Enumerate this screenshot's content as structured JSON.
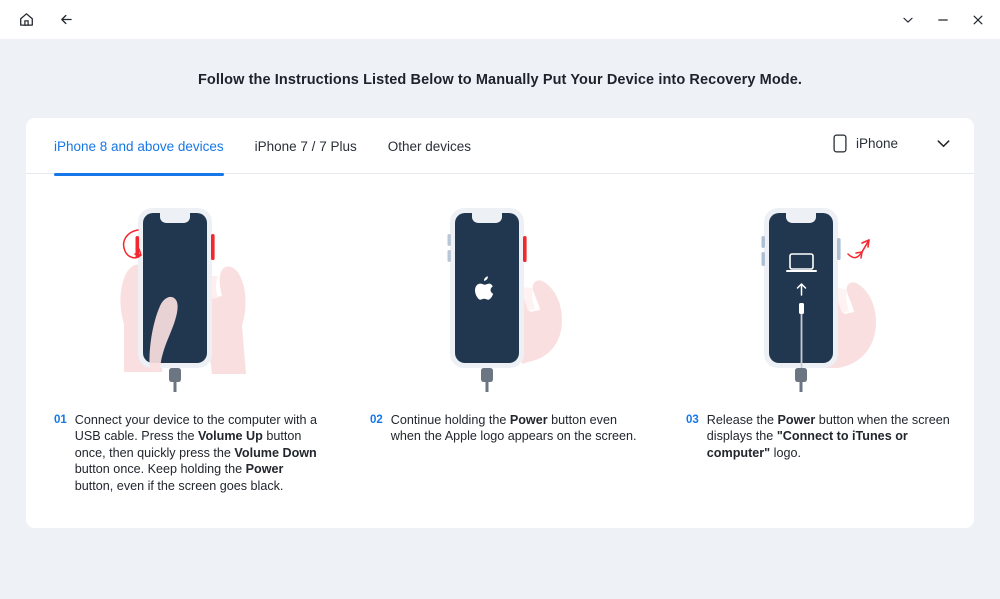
{
  "titlebar": {
    "home_icon": "home-icon",
    "back_icon": "back-arrow-icon",
    "menu_icon": "chevron-down-icon",
    "minimize_icon": "minimize-icon",
    "close_icon": "close-icon"
  },
  "heading": "Follow the Instructions Listed Below to Manually Put Your Device into Recovery Mode.",
  "tabs": [
    {
      "label": "iPhone 8 and above devices",
      "active": true
    },
    {
      "label": "iPhone 7 / 7 Plus",
      "active": false
    },
    {
      "label": "Other devices",
      "active": false
    }
  ],
  "device_select": {
    "icon": "phone-icon",
    "label": "iPhone",
    "chevron": "chevron-down-icon"
  },
  "steps": [
    {
      "number": "01",
      "text_html": "Connect your device to the computer with a USB cable. Press the <b>Volume Up</b> button once, then quickly press the <b>Volume Down</b> button once. Keep holding the <b>Power</b> button, even if the screen goes black.",
      "illustration": "two-hands-holding-iphone-blank-screen"
    },
    {
      "number": "02",
      "text_html": "Continue holding the <b>Power</b> button even when the Apple logo appears on the screen.",
      "illustration": "hand-holding-iphone-apple-logo"
    },
    {
      "number": "03",
      "text_html": "Release the <b>Power</b> button when the screen displays the <b>\"Connect to iTunes or computer\"</b> logo.",
      "illustration": "hand-releasing-iphone-connect-to-itunes"
    }
  ],
  "colors": {
    "background": "#eef2f7",
    "card": "#ffffff",
    "accent": "#1677e8",
    "screen_navy": "#21374f",
    "hand_pink": "#fadfe0",
    "highlight_red": "#f3282f",
    "phone_frame": "#eef1f6"
  }
}
